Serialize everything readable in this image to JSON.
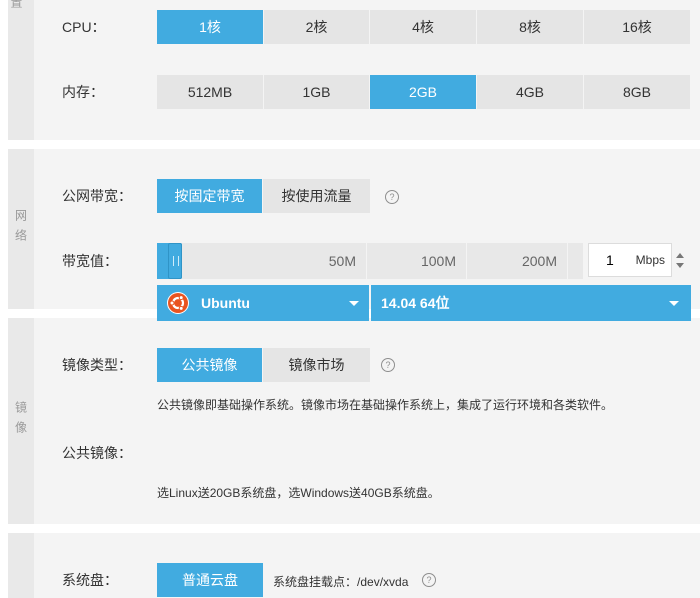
{
  "config": {
    "side_label": "置",
    "cpu": {
      "label": "CPU：",
      "options": [
        "1核",
        "2核",
        "4核",
        "8核",
        "16核"
      ],
      "selected": "1核"
    },
    "memory": {
      "label": "内存：",
      "options": [
        "512MB",
        "1GB",
        "2GB",
        "4GB",
        "8GB"
      ],
      "selected": "2GB"
    }
  },
  "network": {
    "side_label": "网络",
    "bandwidth_type": {
      "label": "公网带宽：",
      "options": [
        "按固定带宽",
        "按使用流量"
      ],
      "selected": "按固定带宽"
    },
    "bandwidth_value": {
      "label": "带宽值：",
      "ticks": [
        "50M",
        "100M",
        "200M"
      ],
      "value": "1",
      "unit": "Mbps"
    },
    "help_glyph": "?"
  },
  "image": {
    "side_label": "镜像",
    "image_type": {
      "label": "镜像类型：",
      "options": [
        "公共镜像",
        "镜像市场"
      ],
      "selected": "公共镜像"
    },
    "type_note": "公共镜像即基础操作系统。镜像市场在基础操作系统上，集成了运行环境和各类软件。",
    "public_image": {
      "label": "公共镜像：",
      "os": "Ubuntu",
      "version": "14.04 64位"
    },
    "disk_note": "选Linux送20GB系统盘，选Windows送40GB系统盘。",
    "help_glyph": "?"
  },
  "storage": {
    "system_disk": {
      "label": "系统盘：",
      "option": "普通云盘",
      "mount_label": "系统盘挂载点：",
      "mount_point": "/dev/xvda"
    },
    "help_glyph": "?"
  },
  "colors": {
    "accent": "#41abe0",
    "option_bg": "#e5e5e5",
    "panel_bg": "#f4f4f4"
  }
}
